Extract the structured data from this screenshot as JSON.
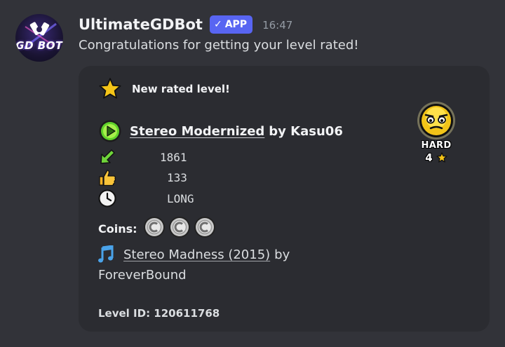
{
  "message": {
    "username": "UltimateGDBot",
    "app_badge": "APP",
    "timestamp": "16:47",
    "content": "Congratulations for getting your level rated!",
    "avatar_text": "GD BOT"
  },
  "embed": {
    "header_label": "New rated level!",
    "level_name": "Stereo Modernized",
    "by_author": "by Kasu06",
    "downloads": "1861",
    "likes": "133",
    "length": "LONG",
    "coins_label": "Coins:",
    "coins_count": 3,
    "song_name": "Stereo Madness (2015)",
    "song_by": "by",
    "song_artist": "ForeverBound",
    "level_id": "Level ID: 120611768",
    "difficulty": {
      "name": "HARD",
      "stars": "4"
    }
  },
  "colors": {
    "background": "#323339",
    "embed_bg": "#2b2c31",
    "app_badge": "#5865f2",
    "star": "#f5c518"
  },
  "icons": {
    "header": "star-icon",
    "play": "play-button-icon",
    "downloads": "download-arrow-icon",
    "likes": "thumbs-up-icon",
    "length": "clock-icon",
    "coins": "silver-coin-icon",
    "song": "music-note-icon",
    "difficulty": "hard-face-icon"
  }
}
